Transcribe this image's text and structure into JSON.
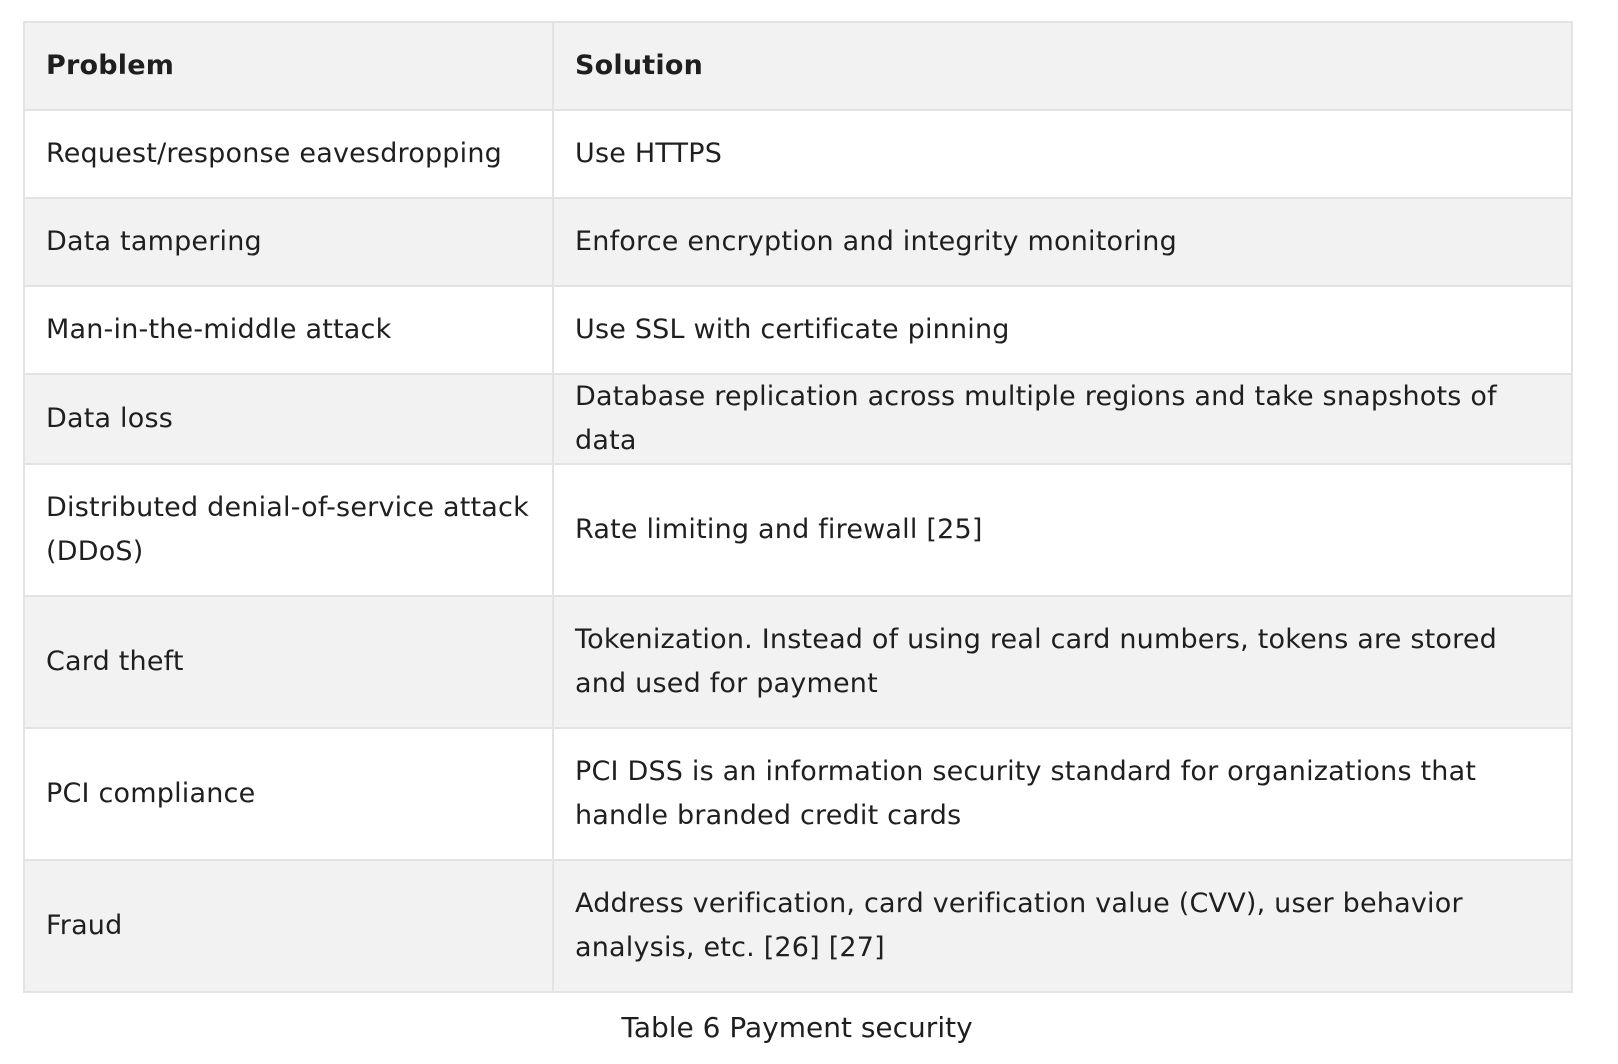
{
  "table": {
    "headers": [
      "Problem",
      "Solution"
    ],
    "rows": [
      [
        "Request/response eavesdropping",
        "Use HTTPS"
      ],
      [
        "Data tampering",
        "Enforce encryption and integrity monitoring"
      ],
      [
        "Man-in-the-middle attack",
        "Use SSL with certificate pinning"
      ],
      [
        "Data loss",
        "Database replication across multiple regions and take snapshots of data"
      ],
      [
        "Distributed denial-of-service attack (DDoS)",
        "Rate limiting and firewall [25]"
      ],
      [
        "Card theft",
        "Tokenization. Instead of using real card numbers, tokens are stored and used for payment"
      ],
      [
        "PCI compliance",
        "PCI DSS is an information security standard for organizations that handle branded credit cards"
      ],
      [
        "Fraud",
        "Address verification, card verification value (CVV), user behavior analysis, etc. [26] [27]"
      ]
    ]
  },
  "caption": "Table 6 Payment security",
  "colors": {
    "header_bg": "#f2f2f2",
    "striped_row_bg": "#f2f2f2",
    "border": "#e3e3e3",
    "text": "#1f1f1f"
  }
}
